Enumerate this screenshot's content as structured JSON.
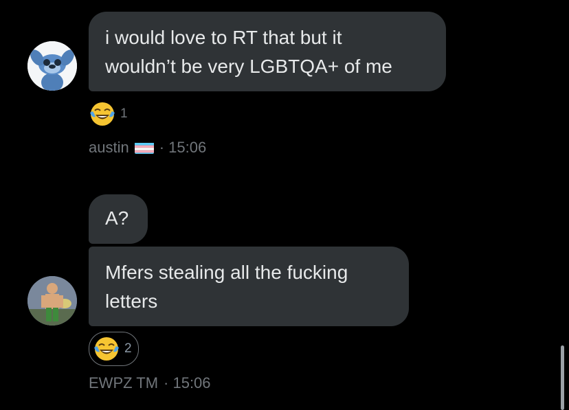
{
  "messages": [
    {
      "lines": [
        "i would love to RT that but it",
        "wouldn’t be very LGBTQA+ of me"
      ],
      "reaction": {
        "emoji_icon": "tears-of-joy-emoji-icon",
        "count": "1"
      },
      "sender": "austin",
      "flag_icon": "transgender-flag-icon",
      "time": "· 15:06"
    },
    {
      "bubbles": [
        {
          "lines": [
            "A?"
          ]
        },
        {
          "lines": [
            "Mfers stealing all the fucking",
            "letters"
          ]
        }
      ],
      "reaction": {
        "emoji_icon": "tears-of-joy-emoji-icon",
        "count": "2"
      },
      "sender": "EWPZ TM",
      "time": "· 15:06"
    }
  ],
  "colors": {
    "background": "#000000",
    "bubble": "#2f3336",
    "text": "#e7e9ea",
    "muted": "#71767b"
  }
}
